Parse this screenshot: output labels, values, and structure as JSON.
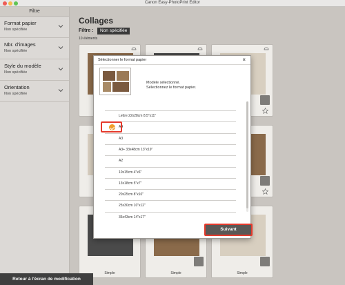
{
  "window": {
    "title": "Canon Easy-PhotoPrint Editor"
  },
  "sidebar": {
    "header": "Filtre",
    "filters": [
      {
        "title": "Format papier",
        "value": "Non spécifiée"
      },
      {
        "title": "Nbr. d'images",
        "value": "Non spécifiée"
      },
      {
        "title": "Style du modèle",
        "value": "Non spécifiée"
      },
      {
        "title": "Orientation",
        "value": "Non spécifiée"
      }
    ],
    "back_button": "Retour à l'écran de modification"
  },
  "main": {
    "title": "Collages",
    "filter_label": "Filtre :",
    "filter_value": "Non spécifiée",
    "count": "10 éléments",
    "card_caption": "Simple"
  },
  "dialog": {
    "title": "Sélectionner le format papier",
    "close": "×",
    "message_line1": "Modèle sélectionné.",
    "message_line2": "Sélectionnez le format papier.",
    "sizes": [
      {
        "label": "Lettre 22x28cm 8.5\"x11\"",
        "selected": false
      },
      {
        "label": "A4",
        "selected": true
      },
      {
        "label": "A3",
        "selected": false
      },
      {
        "label": "A3+ 33x48cm 13\"x19\"",
        "selected": false
      },
      {
        "label": "A2",
        "selected": false
      },
      {
        "label": "10x15cm 4\"x6\"",
        "selected": false
      },
      {
        "label": "13x18cm 5\"x7\"",
        "selected": false
      },
      {
        "label": "20x25cm 8\"x10\"",
        "selected": false
      },
      {
        "label": "25x30cm 10\"x12\"",
        "selected": false
      },
      {
        "label": "36x43cm 14\"x17\"",
        "selected": false
      }
    ],
    "next_button": "Suivant"
  },
  "colors": {
    "highlight": "#e53a2c",
    "check": "#f09d2a"
  }
}
